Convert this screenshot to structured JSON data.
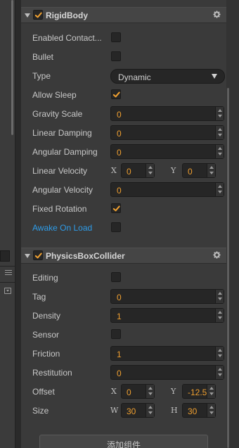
{
  "colors": {
    "panel_bg": "#3a3a3a",
    "header_bg": "#454545",
    "field_bg": "#262626",
    "value_accent": "#f0a030",
    "check_accent": "#f0a030",
    "link_blue": "#2e9ce8"
  },
  "rigidbody": {
    "title": "RigidBody",
    "enabled": true,
    "icon": "gear-icon",
    "props": {
      "enabled_contact_listener": {
        "label": "Enabled Contact...",
        "checked": false
      },
      "bullet": {
        "label": "Bullet",
        "checked": false
      },
      "type": {
        "label": "Type",
        "value": "Dynamic"
      },
      "allow_sleep": {
        "label": "Allow Sleep",
        "checked": true
      },
      "gravity_scale": {
        "label": "Gravity Scale",
        "value": "0"
      },
      "linear_damping": {
        "label": "Linear Damping",
        "value": "0"
      },
      "angular_damping": {
        "label": "Angular Damping",
        "value": "0"
      },
      "linear_velocity": {
        "label": "Linear Velocity",
        "x_label": "X",
        "x": "0",
        "y_label": "Y",
        "y": "0"
      },
      "angular_velocity": {
        "label": "Angular Velocity",
        "value": "0"
      },
      "fixed_rotation": {
        "label": "Fixed Rotation",
        "checked": true
      },
      "awake_on_load": {
        "label": "Awake On Load",
        "checked": false
      }
    }
  },
  "collider": {
    "title": "PhysicsBoxCollider",
    "enabled": true,
    "icon": "gear-icon",
    "props": {
      "editing": {
        "label": "Editing",
        "checked": false
      },
      "tag": {
        "label": "Tag",
        "value": "0"
      },
      "density": {
        "label": "Density",
        "value": "1"
      },
      "sensor": {
        "label": "Sensor",
        "checked": false
      },
      "friction": {
        "label": "Friction",
        "value": "1"
      },
      "restitution": {
        "label": "Restitution",
        "value": "0"
      },
      "offset": {
        "label": "Offset",
        "x_label": "X",
        "x": "0",
        "y_label": "Y",
        "y": "-12.5"
      },
      "size": {
        "label": "Size",
        "w_label": "W",
        "w": "30",
        "h_label": "H",
        "h": "30"
      }
    }
  },
  "add_component": {
    "label": "添加组件"
  }
}
